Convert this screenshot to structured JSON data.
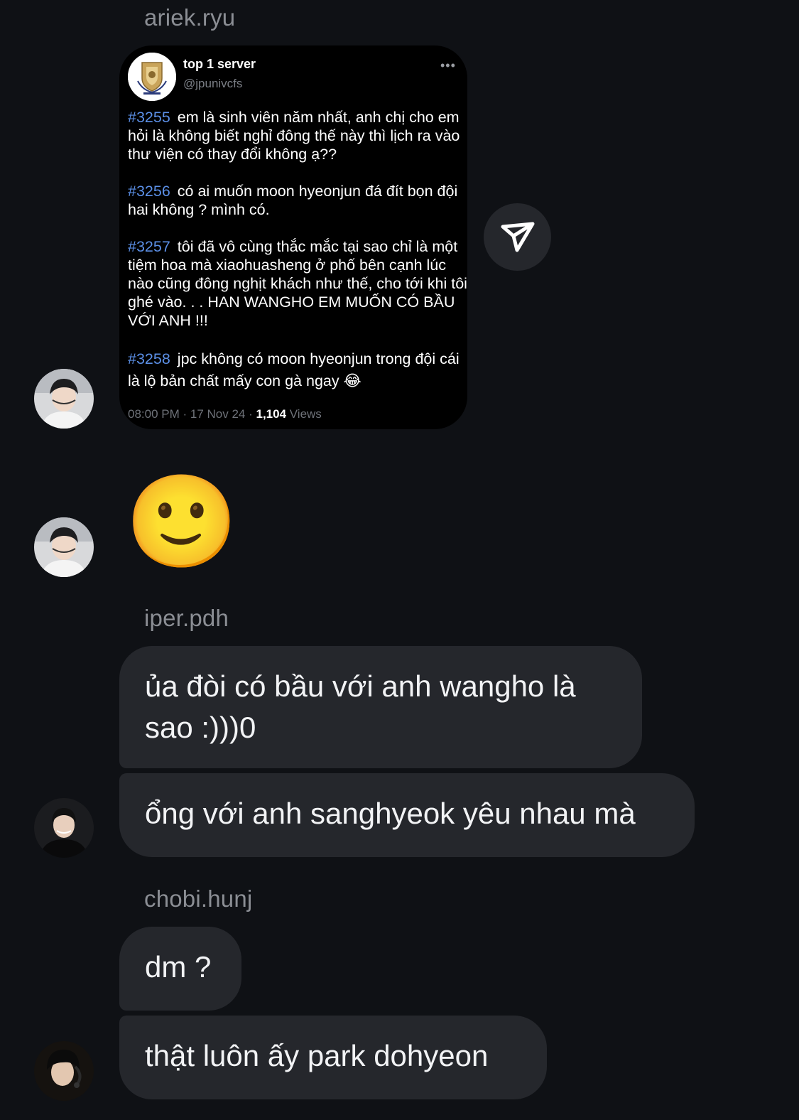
{
  "messages": {
    "sender1": "ariek.ryu",
    "sender2": "iper.pdh",
    "sender3": "chobi.hunj"
  },
  "shared_post": {
    "account_name": "top 1 server",
    "handle": "@jpunivcfs",
    "more_icon": "•••",
    "posts": [
      {
        "tag": "#3255",
        "text": "em là sinh viên năm nhất, anh chị cho em hỏi là không biết nghỉ đông thế này thì lịch ra vào thư viện có thay đổi không ạ??"
      },
      {
        "tag": "#3256",
        "text": "có ai muốn moon hyeonjun đá đít bọn đội hai không ? mình có."
      },
      {
        "tag": "#3257",
        "text": "tôi đã vô cùng thắc mắc tại sao chỉ là một tiệm hoa mà xiaohuasheng ở phố bên cạnh lúc nào cũng đông nghịt khách như thế, cho tới khi tôi ghé vào. . . HAN WANGHO EM MUỐN CÓ BẦU VỚI ANH !!!"
      },
      {
        "tag": "#3258",
        "text": "jpc không có moon hyeonjun trong đội cái là lộ bản chất mấy con gà ngay 😂"
      }
    ],
    "timestamp": "08:00 PM · 17 Nov 24 · ",
    "views_count": "1,104",
    "views_label": "Views"
  },
  "emoji_message": "🙂",
  "bubbles": {
    "b1": "ủa đòi có bầu với anh wangho là sao :)))0",
    "b2": "ổng với anh sanghyeok yêu nhau mà",
    "b3": "dm ?",
    "b4": "thật luôn ấy park dohyeon"
  },
  "icons": {
    "share": "paper-plane-icon",
    "avatar": "avatar"
  },
  "colors": {
    "background": "#0f1115",
    "bubble": "#25272c",
    "hashtag": "#5b8fe6",
    "sender_name": "#8b8e94"
  }
}
